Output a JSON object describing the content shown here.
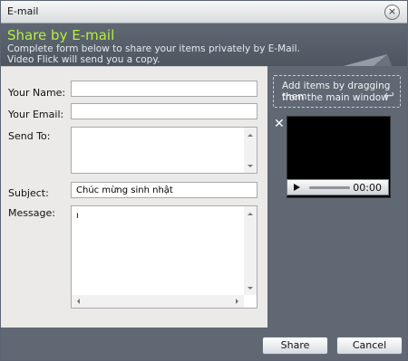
{
  "window": {
    "title": "E-mail"
  },
  "header": {
    "heading": "Share by E-mail",
    "desc1": "Complete form below to share your items privately by E-Mail.",
    "desc2": "Video Flick will send you a copy."
  },
  "form": {
    "name_label": "Your Name:",
    "email_label": "Your Email:",
    "sendto_label": "Send To:",
    "subject_label": "Subject:",
    "message_label": "Message:",
    "name_value": "",
    "email_value": "",
    "sendto_value": "",
    "subject_value": "Chúc mừng sinh nhật",
    "message_value": "ı"
  },
  "side": {
    "drop_line1": "Add items by dragging them",
    "drop_line2": "from the main window",
    "time": "00:00"
  },
  "buttons": {
    "share": "Share",
    "cancel": "Cancel"
  },
  "icons": {
    "close": "close-icon",
    "envelope": "envelope-icon",
    "remove": "remove-icon",
    "play": "play-icon",
    "arrow": "return-arrow-icon"
  },
  "colors": {
    "heading_accent": "#b6f03a",
    "panel": "#5f6873"
  }
}
